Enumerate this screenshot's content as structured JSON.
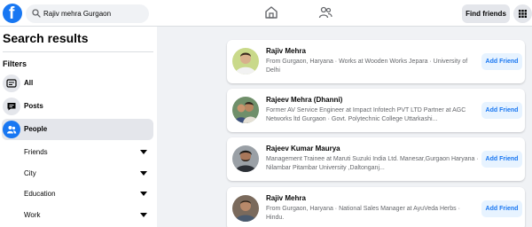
{
  "topbar": {
    "logo_letter": "f",
    "search_value": "Rajiv mehra Gurgaon",
    "find_friends_label": "Find friends"
  },
  "sidebar": {
    "title": "Search results",
    "filters_label": "Filters",
    "items": [
      {
        "label": "All",
        "icon": "feed-icon"
      },
      {
        "label": "Posts",
        "icon": "posts-icon"
      },
      {
        "label": "People",
        "icon": "people-icon",
        "active": true
      }
    ],
    "sub_filters": [
      {
        "label": "Friends"
      },
      {
        "label": "City"
      },
      {
        "label": "Education"
      },
      {
        "label": "Work"
      }
    ]
  },
  "results": [
    {
      "name": "Rajiv Mehra",
      "desc": "From Gurgaon, Haryana · Works at Wooden Works Jepara · University of Delhi",
      "button": "Add Friend"
    },
    {
      "name": "Rajeev Mehra (Dhanni)",
      "desc": "Former AV Service Engineer at Impact Infotech PVT LTD Partner at AGC Networks ltd Gurgaon · Govt. Polytechnic College Uttarkashi...",
      "button": "Add Friend"
    },
    {
      "name": "Rajeev Kumar Maurya",
      "desc": "Management Trainee at Maruti Suzuki India Ltd. Manesar,Gurgaon Haryana · Nilambar Pitambar University ,Daltonganj...",
      "button": "Add Friend"
    },
    {
      "name": "Rajiv Mehra",
      "desc": "From Gurgaon, Haryana · National Sales Manager at AyuVeda Herbs · Hindu.",
      "button": "Add Friend"
    }
  ],
  "colors": {
    "brand": "#1877f2",
    "button_bg": "#e7f3ff",
    "page_bg": "#f0f2f5"
  }
}
